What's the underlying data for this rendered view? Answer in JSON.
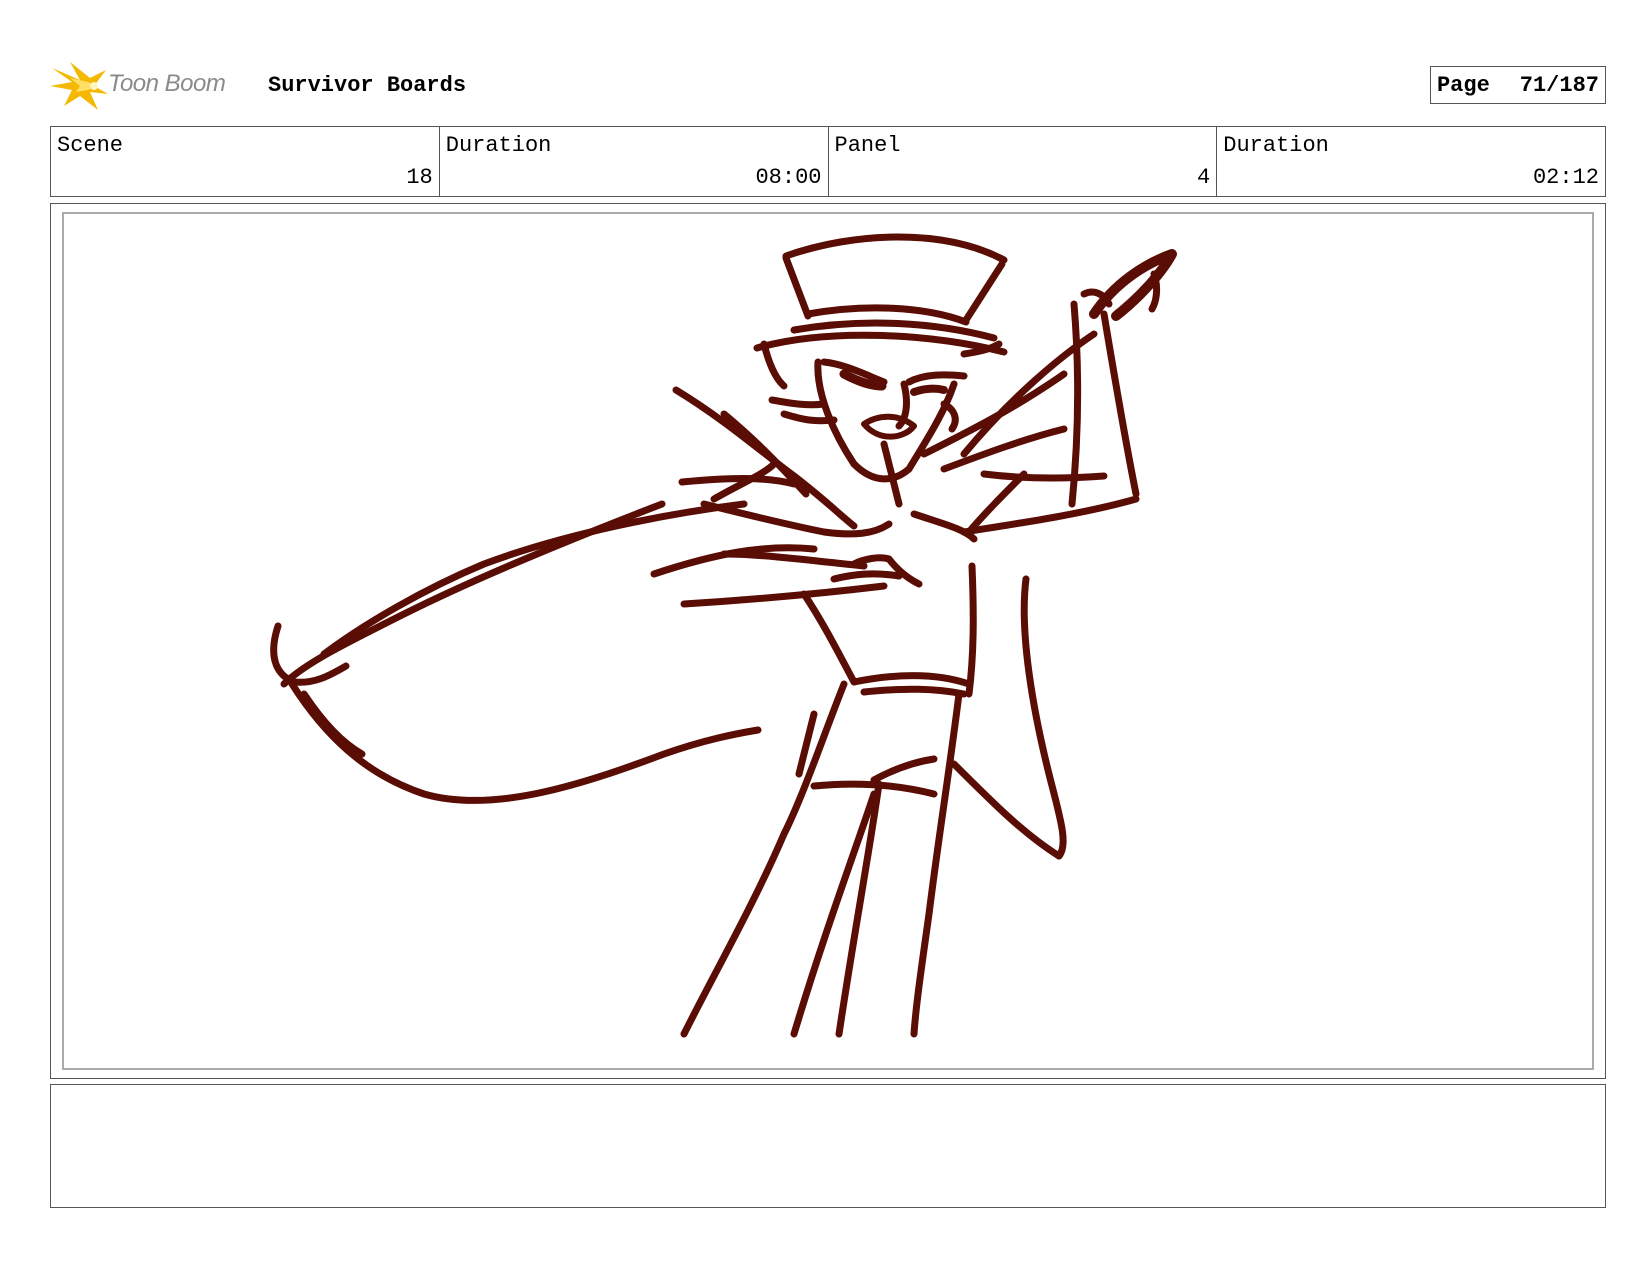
{
  "header": {
    "logo_text": "Toon Boom",
    "project_title": "Survivor Boards",
    "page_label": "Page",
    "page_value": "71/187"
  },
  "info": {
    "scene_label": "Scene",
    "scene_value": "18",
    "scene_duration_label": "Duration",
    "scene_duration_value": "08:00",
    "panel_label": "Panel",
    "panel_value": "4",
    "panel_duration_label": "Duration",
    "panel_duration_value": "02:12"
  },
  "notes": {
    "text": ""
  },
  "colors": {
    "sketch_stroke": "#5a0d04",
    "logo_flash": "#f5b800",
    "logo_text": "#8a8a8a",
    "border": "#555555"
  }
}
